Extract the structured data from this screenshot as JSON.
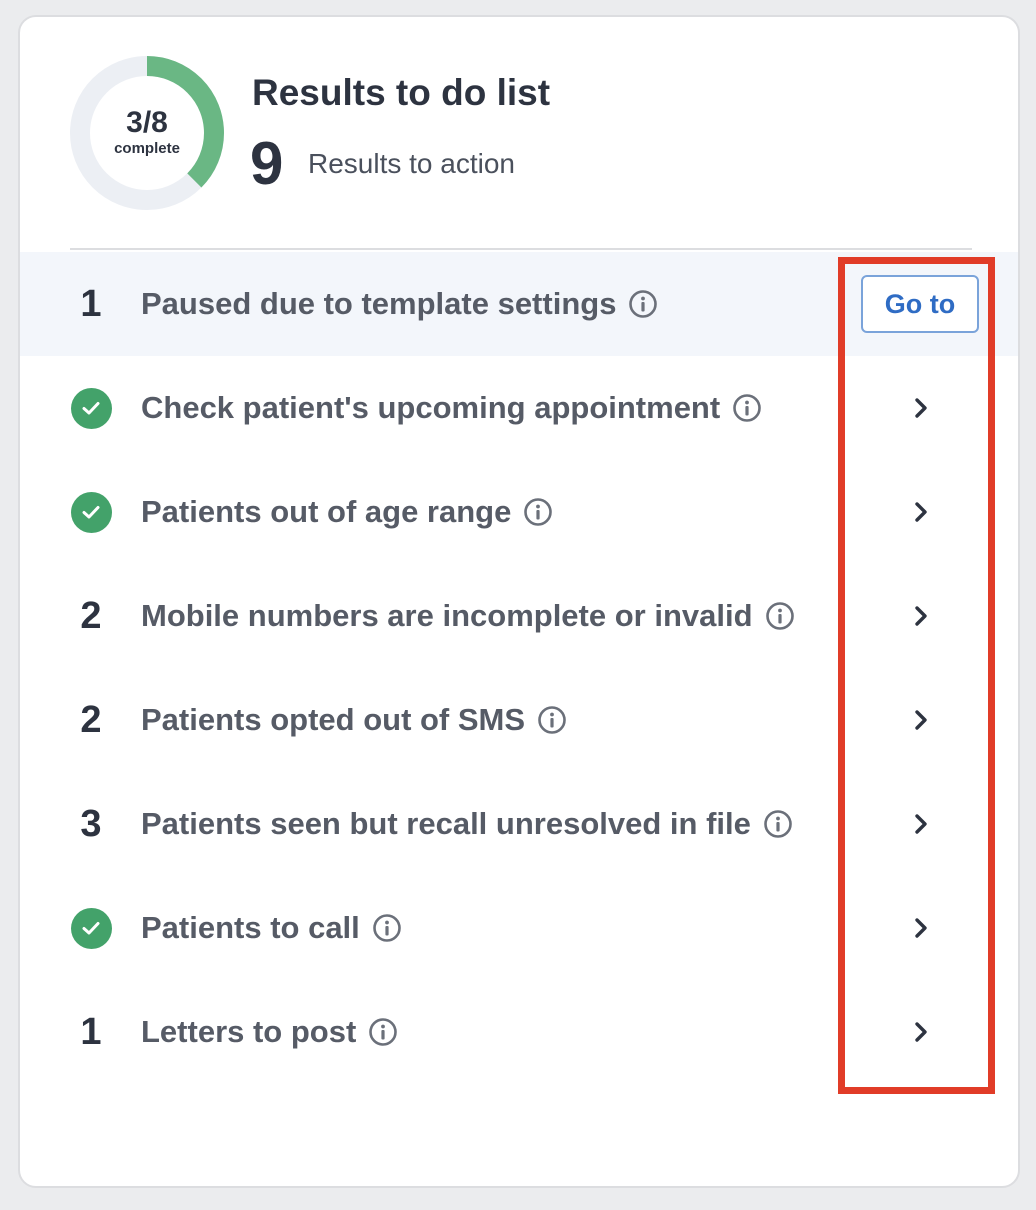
{
  "header": {
    "title": "Results to do list",
    "count": "9",
    "count_label": "Results to action"
  },
  "progress": {
    "fraction_text": "3/8",
    "caption": "complete",
    "completed": 3,
    "total": 8,
    "ring_color": "#6ab784",
    "track_color": "#eceff4"
  },
  "colors": {
    "check_green": "#43a26a",
    "highlight_red": "#e13c28",
    "button_blue": "#2f6cc4"
  },
  "items": [
    {
      "status": "count",
      "count": "1",
      "label": "Paused due to template settings",
      "action": "button",
      "action_label": "Go to",
      "icon": "info-icon"
    },
    {
      "status": "done",
      "count": "",
      "label": "Check patient's upcoming appointment",
      "action": "chevron",
      "action_label": "",
      "icon": "info-icon"
    },
    {
      "status": "done",
      "count": "",
      "label": "Patients out of age range",
      "action": "chevron",
      "action_label": "",
      "icon": "info-icon"
    },
    {
      "status": "count",
      "count": "2",
      "label": "Mobile numbers are incomplete or invalid",
      "action": "chevron",
      "action_label": "",
      "icon": "info-icon"
    },
    {
      "status": "count",
      "count": "2",
      "label": "Patients opted out of SMS",
      "action": "chevron",
      "action_label": "",
      "icon": "info-icon"
    },
    {
      "status": "count",
      "count": "3",
      "label": "Patients seen but recall unresolved in file",
      "action": "chevron",
      "action_label": "",
      "icon": "info-icon"
    },
    {
      "status": "done",
      "count": "",
      "label": "Patients to call",
      "action": "chevron",
      "action_label": "",
      "icon": "info-icon"
    },
    {
      "status": "count",
      "count": "1",
      "label": "Letters to post",
      "action": "chevron",
      "action_label": "",
      "icon": "info-icon"
    }
  ]
}
